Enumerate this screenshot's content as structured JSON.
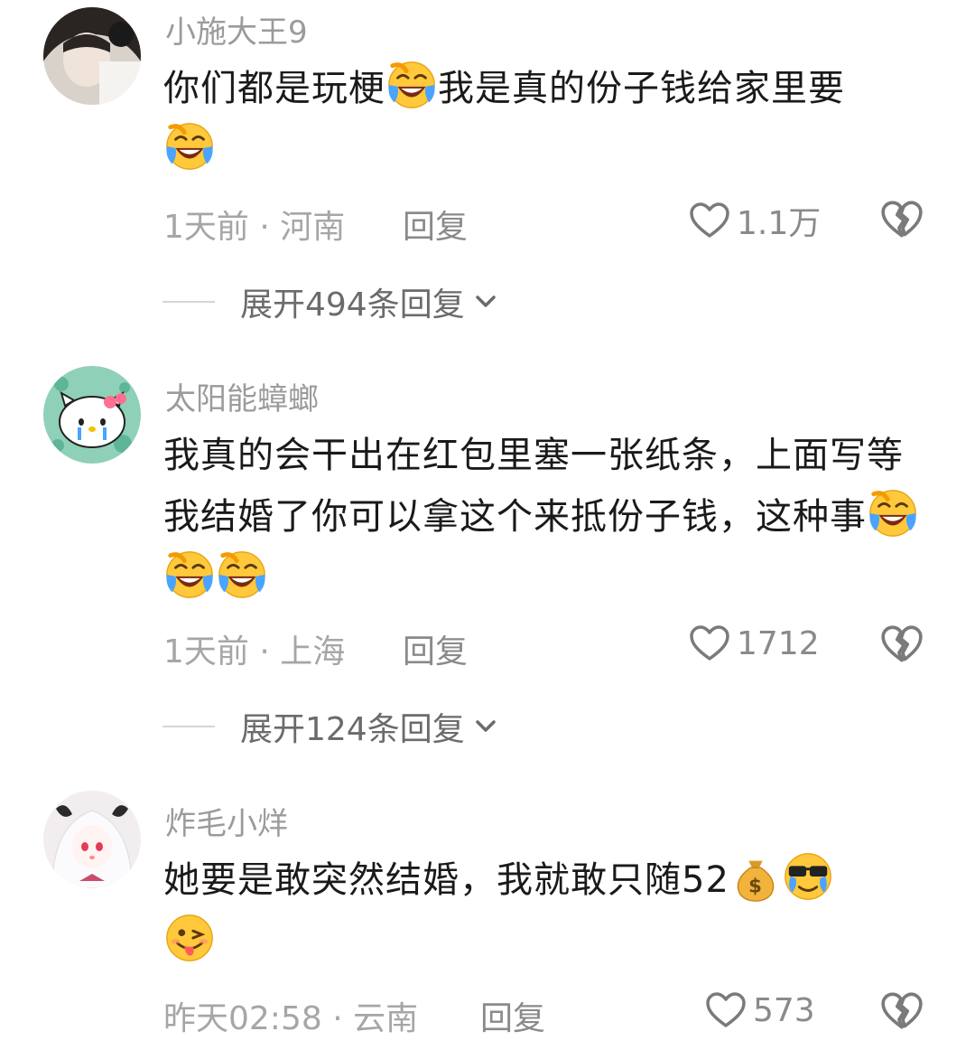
{
  "comments": [
    {
      "username": "小施大王9",
      "text_parts": [
        "你们都是玩梗",
        "我是真的份子钱给家里要"
      ],
      "time": "1天前",
      "location": "河南",
      "reply_label": "回复",
      "likes": "1.1万",
      "expand_label": "展开494条回复"
    },
    {
      "username": "太阳能蟑螂",
      "text_parts": [
        "我真的会干出在红包里塞一张纸条，上面写等我结婚了你可以拿这个来抵份子钱，这种事"
      ],
      "time": "1天前",
      "location": "上海",
      "reply_label": "回复",
      "likes": "1712",
      "expand_label": "展开124条回复"
    },
    {
      "username": "炸毛小烊",
      "text_parts": [
        "她要是敢突然结婚，我就敢只随52"
      ],
      "time": "昨天02:58",
      "location": "云南",
      "reply_label": "回复",
      "likes": "573"
    }
  ],
  "separator": "·",
  "icons": {
    "like": "heart-outline-icon",
    "dislike": "broken-heart-icon",
    "expand": "chevron-down-icon",
    "emoji_laugh_cry": "laughing-crying-emoji",
    "emoji_money_bag": "money-bag-emoji",
    "emoji_sunglasses_cry": "sunglasses-crying-emoji",
    "emoji_wink_tongue": "wink-tongue-emoji"
  }
}
